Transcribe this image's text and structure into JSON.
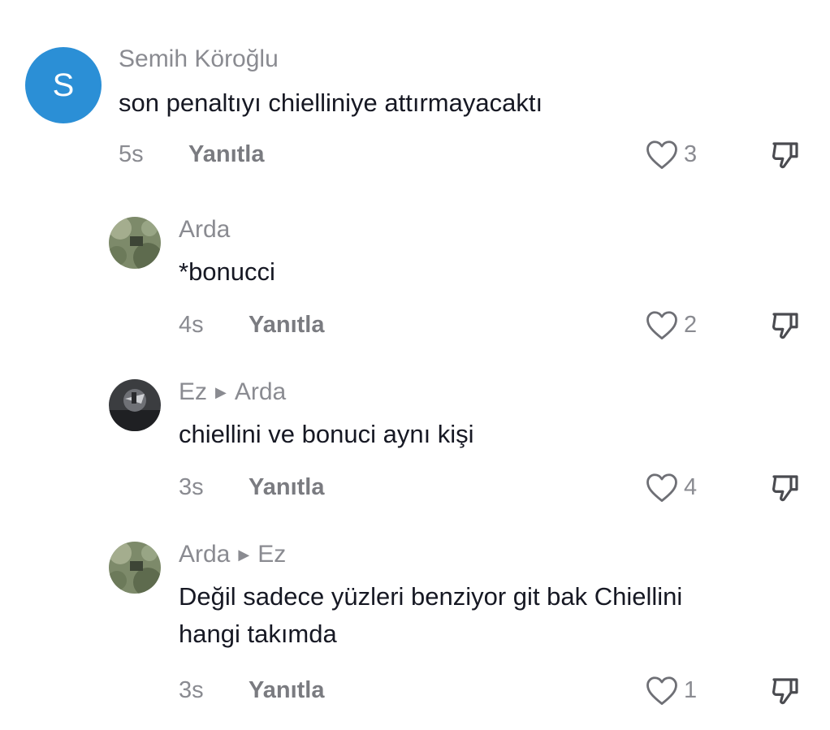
{
  "comments": [
    {
      "avatar_letter": "S",
      "avatar_color": "#2b8fd6",
      "username": "Semih Köroğlu",
      "text": "son penaltıyı chielliniye attırmayacaktı",
      "time": "5s",
      "reply_label": "Yanıtla",
      "likes": "3"
    },
    {
      "username": "Arda",
      "text": "*bonucci",
      "time": "4s",
      "reply_label": "Yanıtla",
      "likes": "2"
    },
    {
      "username": "Ez",
      "reply_to": "Arda",
      "text": "chiellini ve bonuci aynı kişi",
      "time": "3s",
      "reply_label": "Yanıtla",
      "likes": "4"
    },
    {
      "username": "Arda",
      "reply_to": "Ez",
      "text_line1": "Değil sadece yüzleri benziyor git bak Chiellini",
      "text_line2": "hangi takımda",
      "time": "3s",
      "reply_label": "Yanıtla",
      "likes": "1"
    }
  ],
  "icons": {
    "like": "heart-outline-icon",
    "dislike": "thumbs-down-icon",
    "reply_arrow": "play-triangle-icon"
  }
}
